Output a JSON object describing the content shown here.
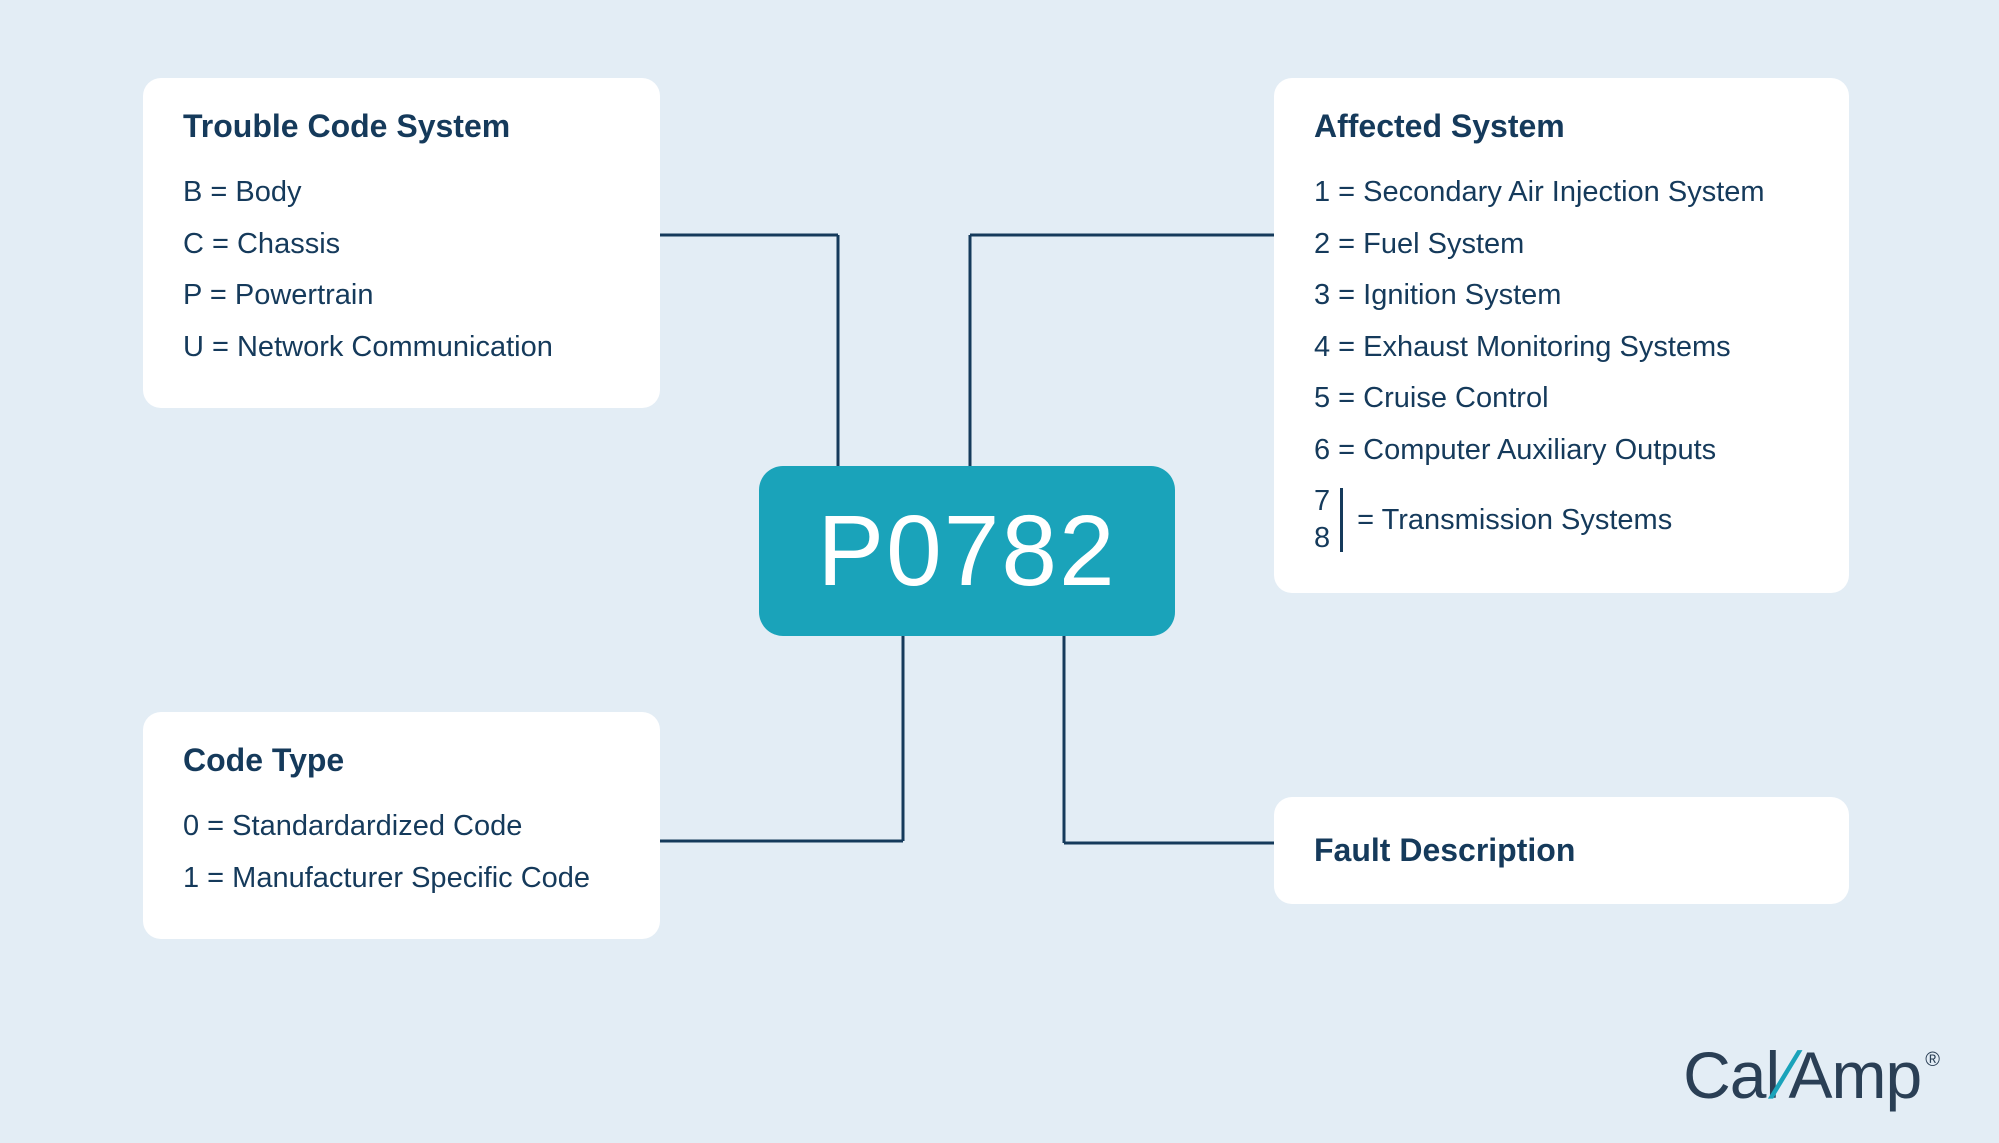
{
  "colors": {
    "background": "#e3edf5",
    "card_bg": "#ffffff",
    "text": "#153a5b",
    "accent": "#1aa3ba"
  },
  "center_code": "P0782",
  "cards": {
    "trouble_code_system": {
      "title": "Trouble Code System",
      "items": [
        "B = Body",
        "C = Chassis",
        "P = Powertrain",
        "U = Network Communication"
      ]
    },
    "affected_system": {
      "title": "Affected System",
      "items": [
        "1 = Secondary Air Injection System",
        "2 = Fuel System",
        "3 = Ignition System",
        "4 = Exhaust Monitoring Systems",
        "5 = Cruise Control",
        "6 = Computer Auxiliary Outputs"
      ],
      "stacked": {
        "nums": [
          "7",
          "8"
        ],
        "label": "= Transmission Systems"
      }
    },
    "code_type": {
      "title": "Code Type",
      "items": [
        "0 = Standardardized Code",
        "1 = Manufacturer Specific Code"
      ]
    },
    "fault_description": {
      "title": "Fault Description"
    }
  },
  "logo": {
    "part1": "Cal",
    "slash": "/",
    "part2": "Amp",
    "reg": "®"
  }
}
